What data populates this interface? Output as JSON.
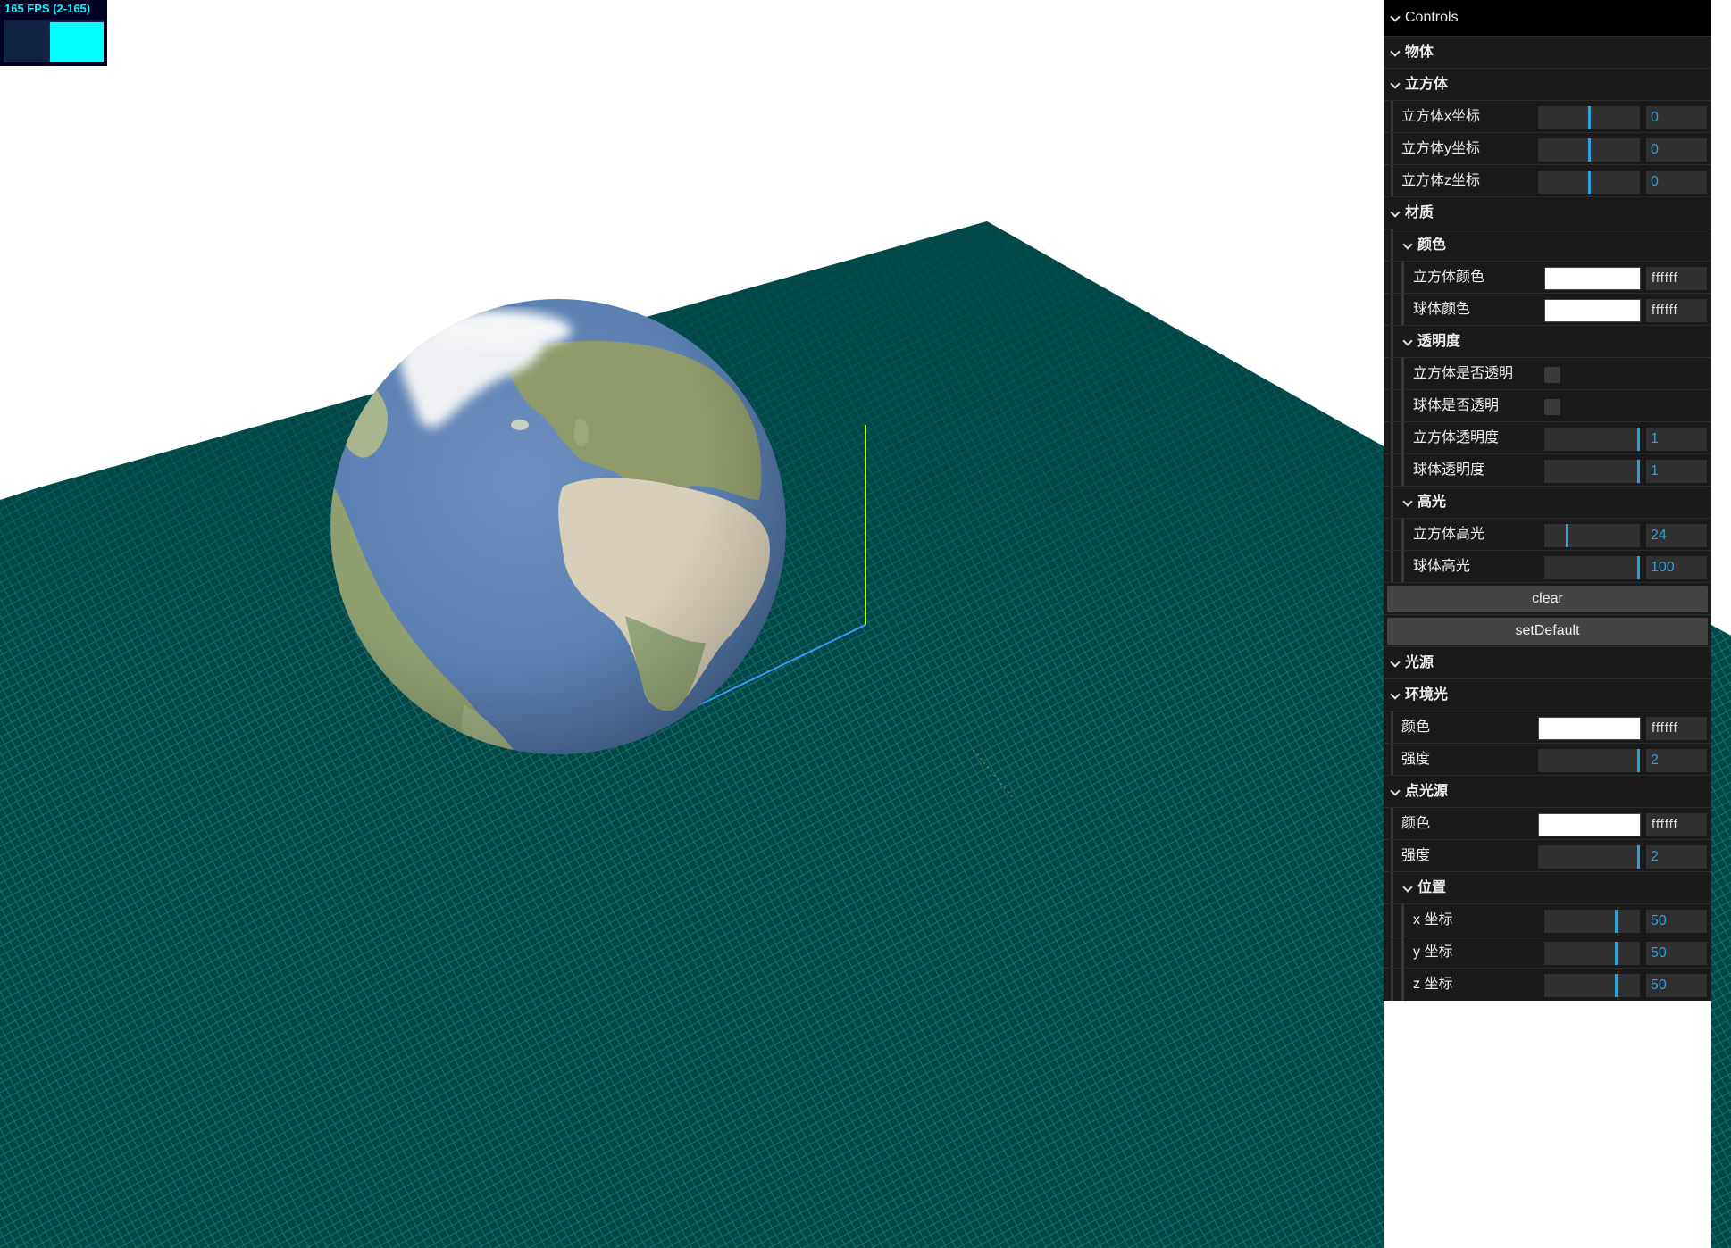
{
  "stats": {
    "fps_text": "165 FPS (2-165)",
    "fps_level": 1.0
  },
  "scene": {
    "floor_color": "#004848",
    "grid_line_color": "#1a6666",
    "axis_y_color": "#aaff00",
    "axis_x_color": "#3399ff"
  },
  "gui": {
    "title": "Controls",
    "accent_color": "#2fa1d6",
    "folders": {
      "object": "物体",
      "cube": "立方体",
      "material": "材质",
      "color": "颜色",
      "transparency": "透明度",
      "highlight": "高光",
      "light_source": "光源",
      "ambient": "环境光",
      "point_light": "点光源",
      "position": "位置"
    },
    "cube": {
      "x": {
        "label": "立方体x坐标",
        "value": "0",
        "level": 0.5
      },
      "y": {
        "label": "立方体y坐标",
        "value": "0",
        "level": 0.5
      },
      "z": {
        "label": "立方体z坐标",
        "value": "0",
        "level": 0.5
      }
    },
    "material": {
      "cube_color": {
        "label": "立方体颜色",
        "value": "ffffff"
      },
      "sphere_color": {
        "label": "球体颜色",
        "value": "ffffff"
      },
      "cube_transparent": {
        "label": "立方体是否透明",
        "checked": false
      },
      "sphere_transparent": {
        "label": "球体是否透明",
        "checked": false
      },
      "cube_opacity": {
        "label": "立方体透明度",
        "value": "1",
        "level": 1.0
      },
      "sphere_opacity": {
        "label": "球体透明度",
        "value": "1",
        "level": 1.0
      },
      "cube_shininess": {
        "label": "立方体高光",
        "value": "24",
        "level": 0.24
      },
      "sphere_shininess": {
        "label": "球体高光",
        "value": "100",
        "level": 1.0
      }
    },
    "buttons": {
      "clear": "clear",
      "set_default": "setDefault"
    },
    "ambient": {
      "color": {
        "label": "颜色",
        "value": "ffffff"
      },
      "intensity": {
        "label": "强度",
        "value": "2",
        "level": 1.0
      }
    },
    "point": {
      "color": {
        "label": "颜色",
        "value": "ffffff"
      },
      "intensity": {
        "label": "强度",
        "value": "2",
        "level": 1.0
      }
    },
    "position": {
      "x": {
        "label": "x 坐标",
        "value": "50",
        "level": 0.75
      },
      "y": {
        "label": "y 坐标",
        "value": "50",
        "level": 0.75
      },
      "z": {
        "label": "z 坐标",
        "value": "50",
        "level": 0.75
      }
    }
  }
}
